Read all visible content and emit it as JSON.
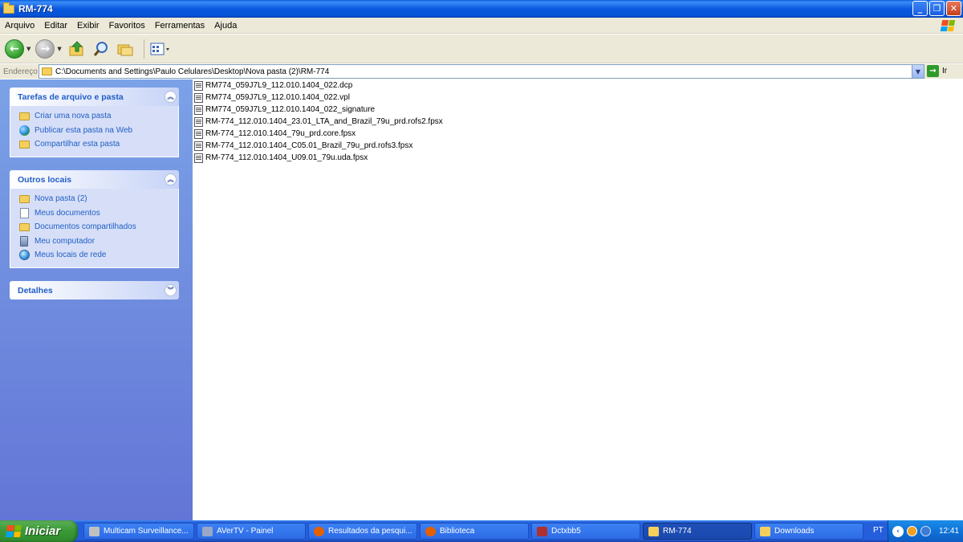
{
  "window": {
    "title": "RM-774",
    "min_label": "_",
    "max_label": "❐",
    "close_label": "✕"
  },
  "menu": {
    "items": [
      "Arquivo",
      "Editar",
      "Exibir",
      "Favoritos",
      "Ferramentas",
      "Ajuda"
    ]
  },
  "toolbar": {
    "icons": [
      "back-icon",
      "forward-icon",
      "up-folder-icon",
      "search-icon",
      "folders-icon",
      "views-icon"
    ]
  },
  "address": {
    "label": "Endereço",
    "path": "C:\\Documents and Settings\\Paulo Celulares\\Desktop\\Nova pasta (2)\\RM-774",
    "go_label": "Ir"
  },
  "sidebar": {
    "tasks": {
      "title": "Tarefas de arquivo e pasta",
      "items": [
        {
          "label": "Criar uma nova pasta",
          "icon": "new-folder-icon"
        },
        {
          "label": "Publicar esta pasta na Web",
          "icon": "globe-icon"
        },
        {
          "label": "Compartilhar esta pasta",
          "icon": "share-folder-icon"
        }
      ]
    },
    "places": {
      "title": "Outros locais",
      "items": [
        {
          "label": "Nova pasta (2)",
          "icon": "folder-icon"
        },
        {
          "label": "Meus documentos",
          "icon": "documents-icon"
        },
        {
          "label": "Documentos compartilhados",
          "icon": "folder-icon"
        },
        {
          "label": "Meu computador",
          "icon": "computer-icon"
        },
        {
          "label": "Meus locais de rede",
          "icon": "network-icon"
        }
      ]
    },
    "details": {
      "title": "Detalhes"
    }
  },
  "files": [
    "RM774_059J7L9_112.010.1404_022.dcp",
    "RM774_059J7L9_112.010.1404_022.vpl",
    "RM774_059J7L9_112.010.1404_022_signature",
    "RM-774_112.010.1404_23.01_LTA_and_Brazil_79u_prd.rofs2.fpsx",
    "RM-774_112.010.1404_79u_prd.core.fpsx",
    "RM-774_112.010.1404_C05.01_Brazil_79u_prd.rofs3.fpsx",
    "RM-774_112.010.1404_U09.01_79u.uda.fpsx"
  ],
  "taskbar": {
    "start_label": "Iniciar",
    "tasks": [
      {
        "label": "Multicam Surveillance...",
        "icon": "camera-icon",
        "color": "#c0c0c0"
      },
      {
        "label": "AVerTV - Painel",
        "icon": "tv-icon",
        "color": "#9aa7c7"
      },
      {
        "label": "Resultados da pesqui...",
        "icon": "firefox-icon",
        "color": "#e66000"
      },
      {
        "label": "Biblioteca",
        "icon": "firefox-icon",
        "color": "#e66000"
      },
      {
        "label": "Dctxbb5",
        "icon": "app-icon",
        "color": "#b03030"
      },
      {
        "label": "RM-774",
        "icon": "folder-icon",
        "color": "#f4cf5c"
      },
      {
        "label": "Downloads",
        "icon": "folder-icon",
        "color": "#f4cf5c"
      }
    ],
    "language": "PT",
    "clock": "12:41"
  }
}
